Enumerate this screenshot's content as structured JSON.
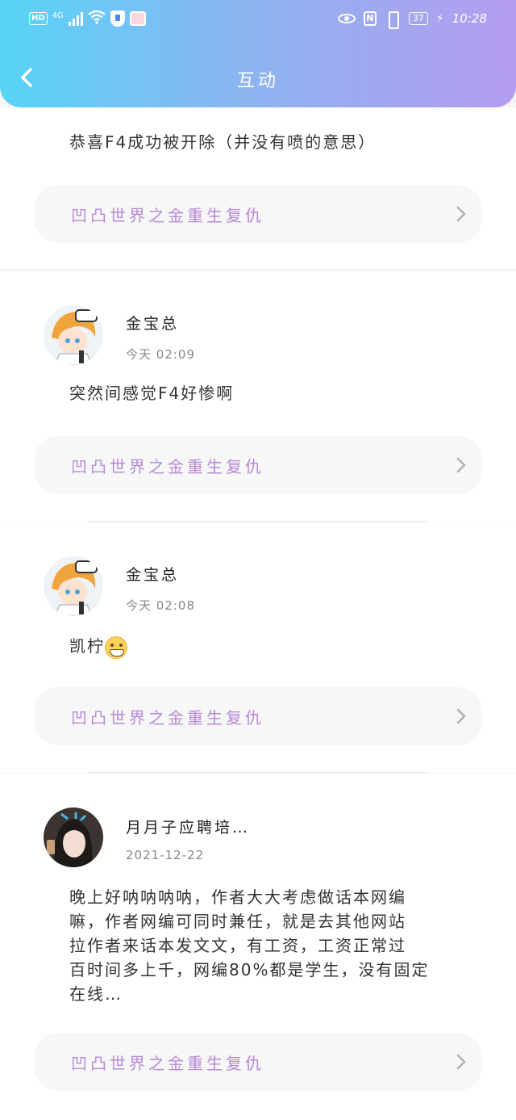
{
  "status_bar": {
    "hd": "HD",
    "network": "4G",
    "battery": "37",
    "time": "10:28",
    "nfc": "N"
  },
  "header": {
    "title": "互动",
    "back_icon": "chevron-left-icon"
  },
  "colors": {
    "header_start": "#57d3f7",
    "header_end": "#b59cf0",
    "link": "#b68ad6"
  },
  "posts": [
    {
      "text": "恭喜F4成功被开除（并没有喷的意思）",
      "link": "凹凸世界之金重生复仇"
    },
    {
      "user": "金宝总",
      "time": "今天  02:09",
      "text": "突然间感觉F4好惨啊",
      "link": "凹凸世界之金重生复仇"
    },
    {
      "user": "金宝总",
      "time": "今天  02:08",
      "text": "凯柠",
      "emoji": "grin-emoji",
      "link": "凹凸世界之金重生复仇"
    },
    {
      "user": "月月子应聘培…",
      "time": "2021-12-22",
      "lines": [
        "晚上好呐呐呐呐，作者大大考虑做话本网编",
        "嘛，作者网编可同时兼任，就是去其他网站",
        "拉作者来话本发文文，有工资，工资正常过",
        "百时间多上千，网编80%都是学生，没有固定",
        "在线…"
      ],
      "link": "凹凸世界之金重生复仇"
    }
  ]
}
